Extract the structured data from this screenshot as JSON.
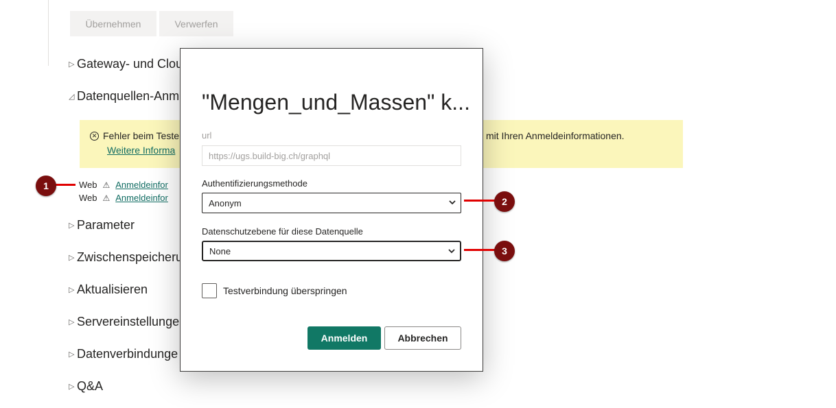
{
  "toolbar": {
    "apply_label": "Übernehmen",
    "discard_label": "Verwerfen"
  },
  "sections": {
    "gateway": "Gateway- und Clou",
    "datasource_creds": "Datenquellen-Anm",
    "parameters": "Parameter",
    "caching": "Zwischenspeicheru",
    "refresh": "Aktualisieren",
    "server": "Servereinstellunge",
    "connections": "Datenverbindunge",
    "qna": "Q&A"
  },
  "warning": {
    "text_left": "Fehler beim Teste",
    "text_right": "mit Ihren Anmeldeinformationen.",
    "link": "Weitere Informa"
  },
  "datasources": [
    {
      "type": "Web",
      "link": "Anmeldeinfor"
    },
    {
      "type": "Web",
      "link": "Anmeldeinfor"
    }
  ],
  "markers": [
    "1",
    "2",
    "3"
  ],
  "dialog": {
    "title": "\"Mengen_und_Massen\" k...",
    "url_label": "url",
    "url_value": "https://ugs.build-big.ch/graphql",
    "auth_label": "Authentifizierungsmethode",
    "auth_value": "Anonym",
    "privacy_label": "Datenschutzebene für diese Datenquelle",
    "privacy_value": "None",
    "skip_test_label": "Testverbindung überspringen",
    "signin_label": "Anmelden",
    "cancel_label": "Abbrechen"
  },
  "colors": {
    "accent": "#117865",
    "warning_bg": "#fbf6bb",
    "marker": "#7a0e0e",
    "marker_line": "#e00000",
    "link": "#106c62"
  },
  "icons": [
    "error-circle-icon",
    "warning-triangle-icon",
    "chevron-down-icon",
    "collapsed-triangle-icon",
    "expanded-triangle-icon"
  ]
}
